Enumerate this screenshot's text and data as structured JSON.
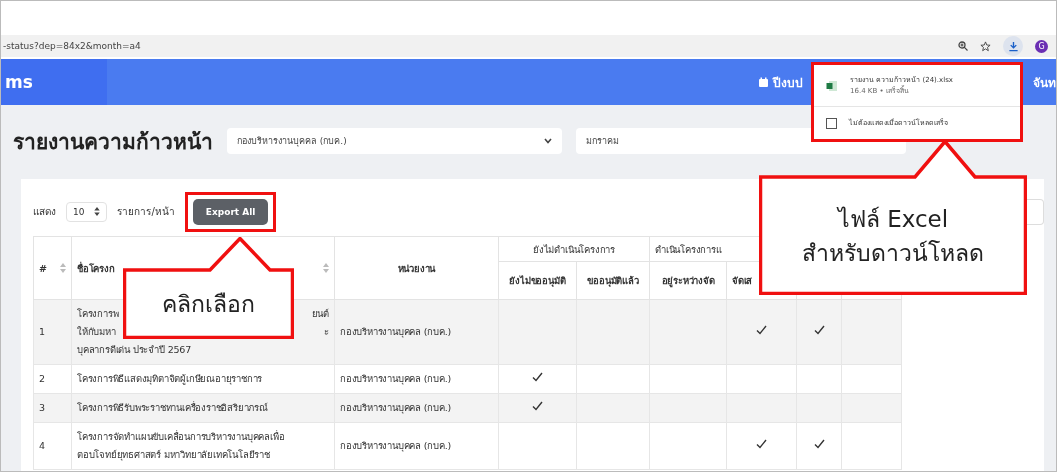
{
  "browser": {
    "url": "-status?dep=84x2&month=a4",
    "avatar": "G"
  },
  "nav": {
    "brand": "ms",
    "items": [
      {
        "label": "ปีงบป"
      },
      {
        "label": "จันท"
      }
    ]
  },
  "download_popup": {
    "file": "รายงาน ความก้าวหน้า (24).xlsx",
    "meta": "16.4 KB • เสร็จสิ้น",
    "option": {
      "label": "ไม่ต้องแสดงเมื่อดาวน์โหลดเสร็จ",
      "checked": false
    }
  },
  "page": {
    "title": "รายงานความก้าวหน้า",
    "filters": [
      {
        "value": "กองบริหารงานบุคคล (กบค.)"
      },
      {
        "value": "มกราคม"
      }
    ]
  },
  "table_controls": {
    "show_label": "แสดง",
    "page_size": "10",
    "per_page_label": "รายการ/หน้า",
    "export_button": "Export All"
  },
  "table": {
    "columns": [
      {
        "label": "#",
        "sortable": true
      },
      {
        "label": "ชื่อโครงก",
        "sortable": true
      },
      {
        "label": "หน่วยงาน",
        "sortable": false
      }
    ],
    "groups": [
      {
        "label": "ยังไม่ดำเนินโครงการ",
        "columns": [
          "ยังไม่ขออนุมัติ",
          "ขออนุมัติแล้ว"
        ]
      },
      {
        "label": "ดำเนินโครงการแ",
        "columns": [
          "อยู่ระหว่างจัด",
          "จัดเส"
        ]
      }
    ],
    "rows": [
      {
        "no": "1",
        "name_lines": [
          [
            "โครงการพ",
            "ยนต์"
          ],
          [
            "ให้กับมหา",
            "ะ"
          ],
          [
            "บุคลากรดีเด่น ประจำปี 2567"
          ]
        ],
        "unit": "กองบริหารงานบุคคล (กบค.)",
        "checks": [
          false,
          false,
          false,
          true,
          true,
          false
        ]
      },
      {
        "no": "2",
        "name_lines": [
          [
            "โครงการพิธีแสดงมุทิตาจิตผู้เกษียณอายุราชการ"
          ]
        ],
        "unit": "กองบริหารงานบุคคล (กบค.)",
        "checks": [
          true,
          false,
          false,
          false,
          false,
          false
        ]
      },
      {
        "no": "3",
        "name_lines": [
          [
            "โครงการพิธีรับพระราชทานเครื่องราชอิสริยาภรณ์"
          ]
        ],
        "unit": "กองบริหารงานบุคคล (กบค.)",
        "checks": [
          true,
          false,
          false,
          false,
          false,
          false
        ]
      },
      {
        "no": "4",
        "name_lines": [
          [
            "โครงการจัดทำแผนขับเคลื่อนการบริหารงานบุคคลเพื่อ"
          ],
          [
            "ตอบโจทย์ยุทธศาสตร์ มหาวิทยาลัยเทคโนโลยีราช"
          ]
        ],
        "unit": "กองบริหารงานบุคคล (กบค.)",
        "checks": [
          false,
          false,
          false,
          true,
          true,
          false
        ]
      }
    ]
  },
  "annotations": [
    {
      "kind": "callout",
      "text": "คลิกเลือก"
    },
    {
      "kind": "callout",
      "lines": [
        "ไฟล์ Excel",
        "สำหรับดาวน์โหลด"
      ]
    }
  ]
}
